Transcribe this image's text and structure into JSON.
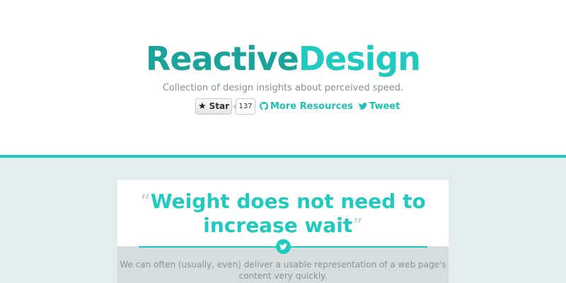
{
  "header": {
    "logo_part1": "Reactive",
    "logo_part2": "Design",
    "tagline": "Collection of design insights about perceived speed."
  },
  "actions": {
    "star_label": "Star",
    "star_count": "137",
    "resources_label": "More Resources",
    "tweet_label": "Tweet"
  },
  "card": {
    "quote_open": "“",
    "quote_line1": "Weight does not need to",
    "quote_line2": "increase wait",
    "quote_close": "”",
    "body_line1": "We can often (usually, even) deliver a usable representation of a web page's",
    "body_line2": "content very quickly."
  },
  "icons": {
    "star": "star-icon",
    "github": "github-icon",
    "twitter": "twitter-icon"
  },
  "colors": {
    "accent": "#1fcbc0",
    "accent_dark": "#1aa39a",
    "muted_text": "#8a8f94",
    "lower_background": "#e3eded"
  }
}
